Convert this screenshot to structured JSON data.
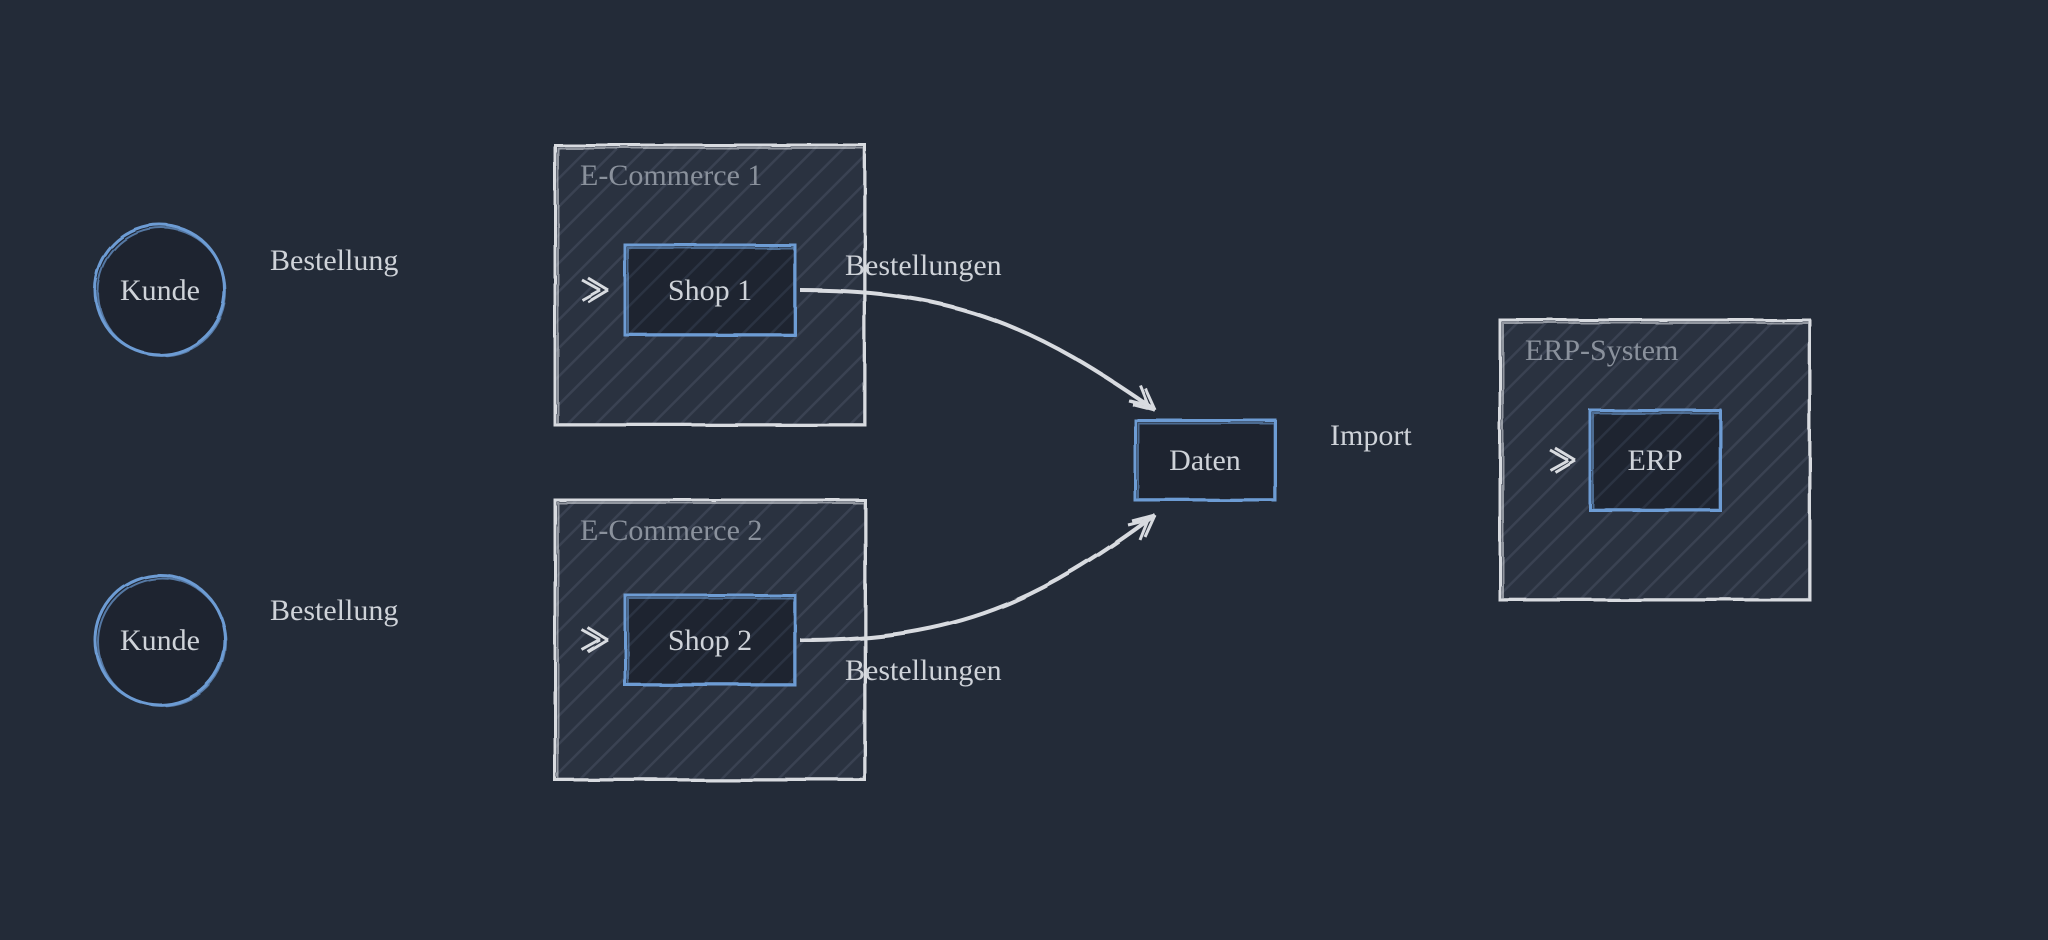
{
  "actors": {
    "customer1": "Kunde",
    "customer2": "Kunde"
  },
  "containers": {
    "ecommerce1": "E-Commerce 1",
    "ecommerce2": "E-Commerce 2",
    "erp_system": "ERP-System"
  },
  "nodes": {
    "shop1": "Shop 1",
    "shop2": "Shop 2",
    "daten": "Daten",
    "erp": "ERP"
  },
  "edges": {
    "order1": "Bestellung",
    "order2": "Bestellung",
    "orders1": "Bestellungen",
    "orders2": "Bestellungen",
    "import": "Import"
  },
  "colors": {
    "bg": "#232b38",
    "line_light": "#d8dbe0",
    "line_blue": "#6d9cd4",
    "text": "#cfd3d9",
    "text_dim": "#8a919c",
    "fill_dark": "#1e2430",
    "fill_darker": "#1a1f29"
  }
}
